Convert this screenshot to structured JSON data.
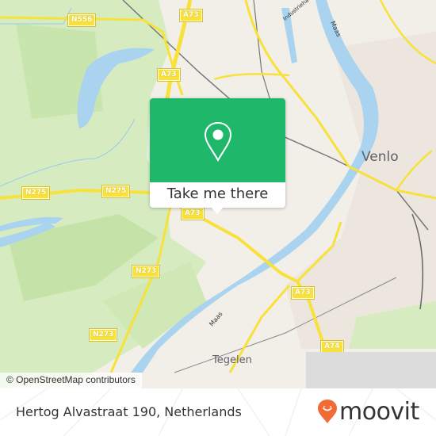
{
  "map": {
    "road_shields": [
      {
        "id": "n556",
        "label": "N556"
      },
      {
        "id": "a73-top",
        "label": "A73"
      },
      {
        "id": "a73-mid",
        "label": "A73"
      },
      {
        "id": "n275-left",
        "label": "N275"
      },
      {
        "id": "n275-right",
        "label": "N275"
      },
      {
        "id": "a73-popup",
        "label": "A73"
      },
      {
        "id": "n273-upper",
        "label": "N273"
      },
      {
        "id": "n273-lower",
        "label": "N273"
      },
      {
        "id": "a73-south",
        "label": "A73"
      },
      {
        "id": "a74",
        "label": "A74"
      }
    ],
    "places": {
      "venlo": "Venlo",
      "tegelen": "Tegelen"
    },
    "water_labels": {
      "maas_north": "Maas",
      "maas_south": "Maas",
      "industriehaven": "Industriehaven"
    },
    "attribution": "© OpenStreetMap contributors"
  },
  "popup": {
    "icon": "map-pin-icon",
    "button_label": "Take me there",
    "accent_color": "#1fb86b"
  },
  "footer": {
    "address": "Hertog Alvastraat 190, Netherlands",
    "brand": "moovit",
    "brand_color": "#f26a36"
  }
}
